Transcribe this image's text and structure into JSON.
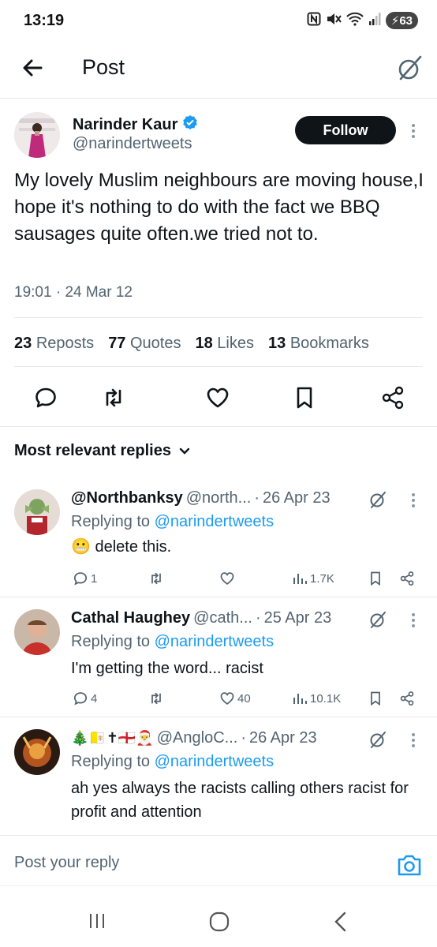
{
  "status_bar": {
    "time": "13:19",
    "battery": "63",
    "icons": [
      "nfc-icon",
      "mute-icon",
      "wifi-icon",
      "signal-icon",
      "battery-icon"
    ]
  },
  "header": {
    "title": "Post",
    "back_icon": "back-arrow-icon",
    "grok_icon": "grok-icon"
  },
  "post": {
    "author_name": "Narinder Kaur",
    "verified": true,
    "author_handle": "@narindertweets",
    "follow_label": "Follow",
    "text": "My lovely Muslim neighbours are moving house,I hope it's nothing to do with the fact we BBQ sausages quite often.we tried not to.",
    "time": "19:01",
    "date": "24 Mar 12",
    "stats": [
      {
        "count": "23",
        "label": "Reposts"
      },
      {
        "count": "77",
        "label": "Quotes"
      },
      {
        "count": "18",
        "label": "Likes"
      },
      {
        "count": "13",
        "label": "Bookmarks"
      }
    ],
    "actions": [
      "reply-icon",
      "repost-icon",
      "like-icon",
      "bookmark-icon",
      "share-icon"
    ]
  },
  "replies_header": {
    "label": "Most relevant replies"
  },
  "replies": [
    {
      "name": "@Northbanksy",
      "handle": "@north...",
      "separator": "·",
      "date": "26 Apr 23",
      "replying_prefix": "Replying to",
      "replying_to": "@narindertweets",
      "emoji": "😬",
      "text": "delete this.",
      "reply_count": "1",
      "repost_count": "",
      "like_count": "",
      "views": "1.7K"
    },
    {
      "name": "Cathal Haughey",
      "handle": "@cath...",
      "separator": "·",
      "date": "25 Apr 23",
      "replying_prefix": "Replying to",
      "replying_to": "@narindertweets",
      "text": "I'm getting the word... racist",
      "reply_count": "4",
      "repost_count": "",
      "like_count": "40",
      "views": "10.1K"
    },
    {
      "name_emojis": "🎄🇻🇦✝🏴󠁧󠁢󠁥󠁮󠁧󠁿🎅",
      "handle": "@AngloC...",
      "separator": "·",
      "date": "26 Apr 23",
      "replying_prefix": "Replying to",
      "replying_to": "@narindertweets",
      "text": "ah yes always the racists calling others racist for profit and attention"
    }
  ],
  "composer": {
    "placeholder": "Post your reply",
    "camera_icon": "camera-icon"
  },
  "nav_bar": {
    "items": [
      "recents-icon",
      "home-icon",
      "back-icon"
    ]
  },
  "colors": {
    "link": "#1d9bf0",
    "verified": "#1d9bf0",
    "text": "#0f1419",
    "muted": "#536471",
    "follow_bg": "#0f1419"
  }
}
